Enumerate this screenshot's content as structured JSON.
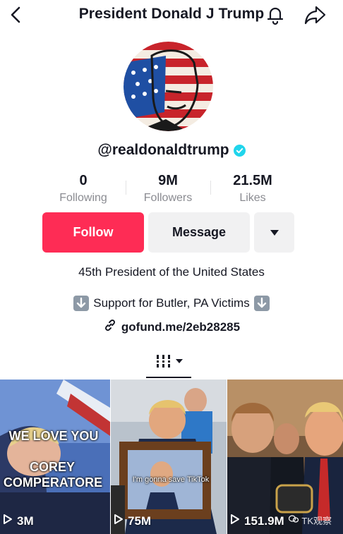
{
  "header": {
    "title": "President Donald J Trump"
  },
  "profile": {
    "handle": "@realdonaldtrump",
    "verified": true,
    "stats": [
      {
        "value": "0",
        "label": "Following"
      },
      {
        "value": "9M",
        "label": "Followers"
      },
      {
        "value": "21.5M",
        "label": "Likes"
      }
    ],
    "follow_label": "Follow",
    "message_label": "Message",
    "bio": "45th President of the United States",
    "support_text": "Support for Butler, PA Victims",
    "link": "gofund.me/2eb28285"
  },
  "videos": [
    {
      "caption_line1": "WE LOVE YOU",
      "caption_line2": "COREY",
      "caption_line3": "COMPERATORE",
      "views": "3M"
    },
    {
      "caption": "I'm gonna save TikTok",
      "views": "75M"
    },
    {
      "views": "151.9M",
      "watermark": "TK观察"
    }
  ],
  "colors": {
    "follow": "#fe2c55",
    "verified": "#20d5ec",
    "muted": "#8a8b91"
  }
}
